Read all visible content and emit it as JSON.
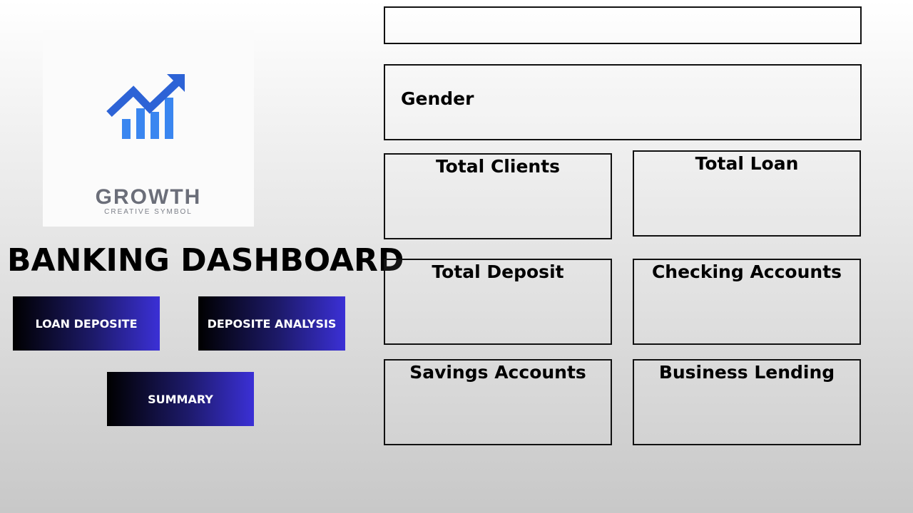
{
  "logo": {
    "brand": "GROWTH",
    "tagline": "CREATIVE SYMBOL",
    "colors": {
      "arrow": "#2d63d6",
      "bars": "#3a86f0",
      "text": "#6b6e79"
    }
  },
  "dashboard_title": "BANKING DASHBOARD",
  "nav": {
    "loan_deposit": "LOAN DEPOSITE",
    "deposit_analysis": "DEPOSITE ANALYSIS",
    "summary": "SUMMARY"
  },
  "panels": {
    "gender": "Gender",
    "total_clients": "Total Clients",
    "total_loan": "Total Loan",
    "total_deposit": "Total Deposit",
    "checking_accounts": "Checking Accounts",
    "savings_accounts": "Savings Accounts",
    "business_lending": "Business Lending"
  },
  "theme": {
    "button_gradient": [
      "#000000",
      "#3b30d6"
    ],
    "background_gradient": [
      "#ffffff",
      "#c8c8c8"
    ]
  }
}
